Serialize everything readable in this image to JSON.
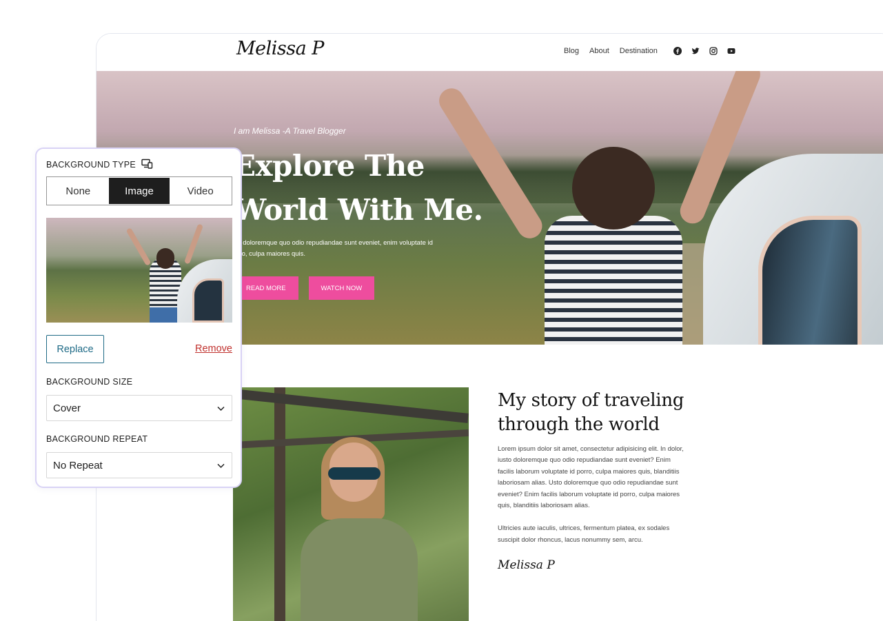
{
  "site": {
    "logo": "Melissa P",
    "nav": [
      "Blog",
      "About",
      "Destination"
    ],
    "social_icons": [
      "facebook-icon",
      "twitter-icon",
      "instagram-icon",
      "youtube-icon"
    ],
    "hero": {
      "kicker": "I am Melissa -A Travel Blogger",
      "title_line1": "Explore The",
      "title_line2": "World With Me.",
      "subtitle_line1": "ou doloremque quo odio repudiandae sunt eveniet, enim voluptate id",
      "subtitle_line2": "orro, culpa maiores quis.",
      "button_primary": "READ MORE",
      "button_secondary": "WATCH NOW"
    },
    "story": {
      "title": "My story of traveling through the world",
      "paragraph1": "Lorem ipsum dolor sit amet, consectetur adipisicing elit. In dolor, iusto doloremque quo odio repudiandae sunt eveniet? Enim facilis laborum voluptate id porro, culpa maiores quis, blanditiis laboriosam alias. Usto doloremque quo odio repudiandae sunt eveniet? Enim facilis laborum voluptate id porro, culpa maiores quis, blanditiis laboriosam alias.",
      "paragraph2": "Ultricies aute iaculis, ultrices, fermentum platea, ex sodales suscipit dolor rhoncus, lacus nonummy sem, arcu.",
      "signature": "Melissa P"
    },
    "accent_color": "#ee4d9e"
  },
  "panel": {
    "background_type_label": "BACKGROUND TYPE",
    "type_options": [
      "None",
      "Image",
      "Video"
    ],
    "selected_type": "Image",
    "replace_label": "Replace",
    "remove_label": "Remove",
    "background_size_label": "BACKGROUND SIZE",
    "background_size_value": "Cover",
    "background_repeat_label": "BACKGROUND REPEAT",
    "background_repeat_value": "No Repeat",
    "accent_color": "#1e6a86",
    "danger_color": "#c0302d"
  }
}
